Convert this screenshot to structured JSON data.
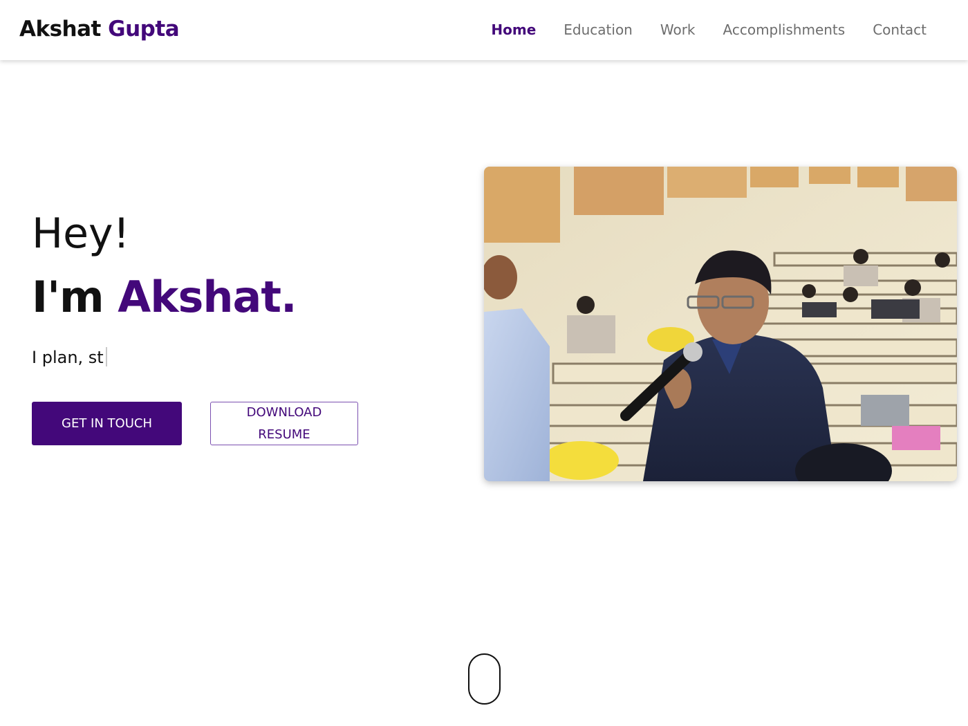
{
  "header": {
    "brand_first": "Akshat",
    "brand_last": "Gupta",
    "nav": [
      {
        "label": "Home",
        "active": true
      },
      {
        "label": "Education",
        "active": false
      },
      {
        "label": "Work",
        "active": false
      },
      {
        "label": "Accomplishments",
        "active": false
      },
      {
        "label": "Contact",
        "active": false
      }
    ]
  },
  "hero": {
    "greeting": "Hey!",
    "intro_prefix": "I'm ",
    "intro_name": "Akshat.",
    "typed_text": "I plan, st",
    "primary_button": "GET IN TOUCH",
    "secondary_button": "DOWNLOAD RESUME"
  },
  "scroll_indicator": {
    "icon": "mouse-scroll-icon"
  },
  "colors": {
    "accent": "#43087a",
    "nav_text": "#6d6d6d",
    "text": "#111111",
    "background": "#ffffff"
  }
}
